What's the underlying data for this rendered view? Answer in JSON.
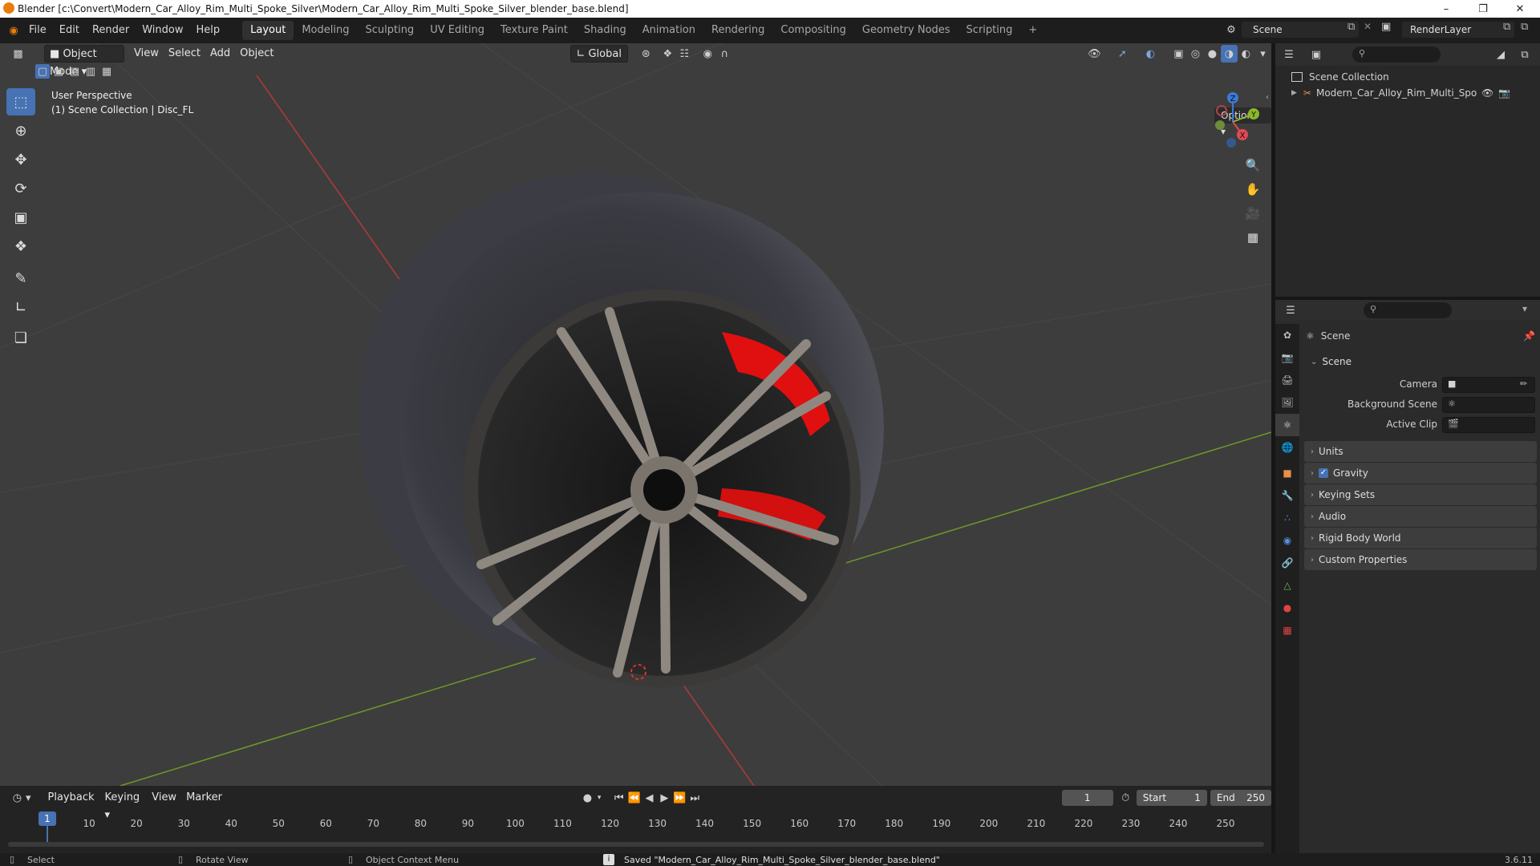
{
  "window": {
    "title": "Blender [c:\\Convert\\Modern_Car_Alloy_Rim_Multi_Spoke_Silver\\Modern_Car_Alloy_Rim_Multi_Spoke_Silver_blender_base.blend]"
  },
  "menu": {
    "items": [
      "File",
      "Edit",
      "Render",
      "Window",
      "Help"
    ]
  },
  "workspaces": {
    "tabs": [
      "Layout",
      "Modeling",
      "Sculpting",
      "UV Editing",
      "Texture Paint",
      "Shading",
      "Animation",
      "Rendering",
      "Compositing",
      "Geometry Nodes",
      "Scripting"
    ],
    "active": "Layout",
    "add_label": "+"
  },
  "scene_selector": {
    "label": "Scene"
  },
  "renderlayer_selector": {
    "label": "RenderLayer"
  },
  "viewport": {
    "mode": "Object Mode",
    "menus": [
      "View",
      "Select",
      "Add",
      "Object"
    ],
    "orientation": "Global",
    "options_label": "Options",
    "overlay_line1": "User Perspective",
    "overlay_line2": "(1) Scene Collection | Disc_FL",
    "gizmo_axes": {
      "z": "Z",
      "y": "Y",
      "x": "X"
    },
    "colors": {
      "x_axis": "#c13b3b",
      "y_axis": "#6d9a2a",
      "caliper": "#e01010",
      "active_tool": "#4772b3"
    }
  },
  "timeline": {
    "menus": [
      "Playback",
      "Keying",
      "View",
      "Marker"
    ],
    "current_frame": "1",
    "start_label": "Start",
    "start_value": "1",
    "end_label": "End",
    "end_value": "250",
    "ticks": [
      "1",
      "10",
      "20",
      "30",
      "40",
      "50",
      "60",
      "70",
      "80",
      "90",
      "100",
      "110",
      "120",
      "130",
      "140",
      "150",
      "160",
      "170",
      "180",
      "190",
      "200",
      "210",
      "220",
      "230",
      "240",
      "250"
    ]
  },
  "outliner": {
    "root": "Scene Collection",
    "item": "Modern_Car_Alloy_Rim_Multi_Spoke_Sil"
  },
  "properties": {
    "context_title": "Scene",
    "panel_title": "Scene",
    "camera_label": "Camera",
    "background_scene_label": "Background Scene",
    "active_clip_label": "Active Clip",
    "sections": [
      "Units",
      "Gravity",
      "Keying Sets",
      "Audio",
      "Rigid Body World",
      "Custom Properties"
    ],
    "gravity_checked": true
  },
  "statusbar": {
    "select": "Select",
    "rotate": "Rotate View",
    "context_menu": "Object Context Menu",
    "message": "Saved \"Modern_Car_Alloy_Rim_Multi_Spoke_Silver_blender_base.blend\"",
    "version": "3.6.11"
  }
}
